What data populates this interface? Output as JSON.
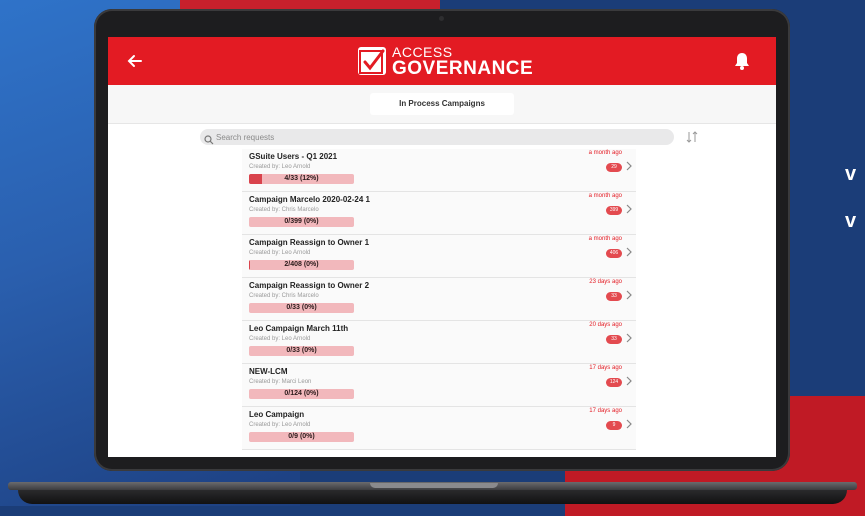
{
  "background": {
    "side_text": [
      "",
      "v",
      "v"
    ]
  },
  "header": {
    "logo_line1": "ACCESS",
    "logo_line2": "GOVERNANCE"
  },
  "tabs": {
    "active": "In Process Campaigns"
  },
  "search": {
    "placeholder": "Search requests"
  },
  "campaigns": [
    {
      "title": "GSuite Users - Q1 2021",
      "creator": "Created by: Leo Arnold",
      "progress_label": "4/33 (12%)",
      "progress_pct": 12,
      "time": "a month ago",
      "badge": "29"
    },
    {
      "title": "Campaign Marcelo 2020-02-24 1",
      "creator": "Created by: Chris Marcelo",
      "progress_label": "0/399 (0%)",
      "progress_pct": 0,
      "time": "a month ago",
      "badge": "399"
    },
    {
      "title": "Campaign Reassign to Owner 1",
      "creator": "Created by: Leo Arnold",
      "progress_label": "2/408 (0%)",
      "progress_pct": 0.5,
      "time": "a month ago",
      "badge": "406"
    },
    {
      "title": "Campaign Reassign to Owner 2",
      "creator": "Created by: Chris Marcelo",
      "progress_label": "0/33 (0%)",
      "progress_pct": 0,
      "time": "23 days ago",
      "badge": "33"
    },
    {
      "title": "Leo Campaign March 11th",
      "creator": "Created by: Leo Arnold",
      "progress_label": "0/33 (0%)",
      "progress_pct": 0,
      "time": "20 days ago",
      "badge": "33"
    },
    {
      "title": "NEW-LCM",
      "creator": "Created by: Marci Leon",
      "progress_label": "0/124 (0%)",
      "progress_pct": 0,
      "time": "17 days ago",
      "badge": "124"
    },
    {
      "title": "Leo Campaign",
      "creator": "Created by: Leo Arnold",
      "progress_label": "0/9 (0%)",
      "progress_pct": 0,
      "time": "17 days ago",
      "badge": "9"
    }
  ],
  "colors": {
    "brand_red": "#e31b23",
    "progress_track": "#f2b8bc",
    "progress_fill": "#d9434c"
  }
}
